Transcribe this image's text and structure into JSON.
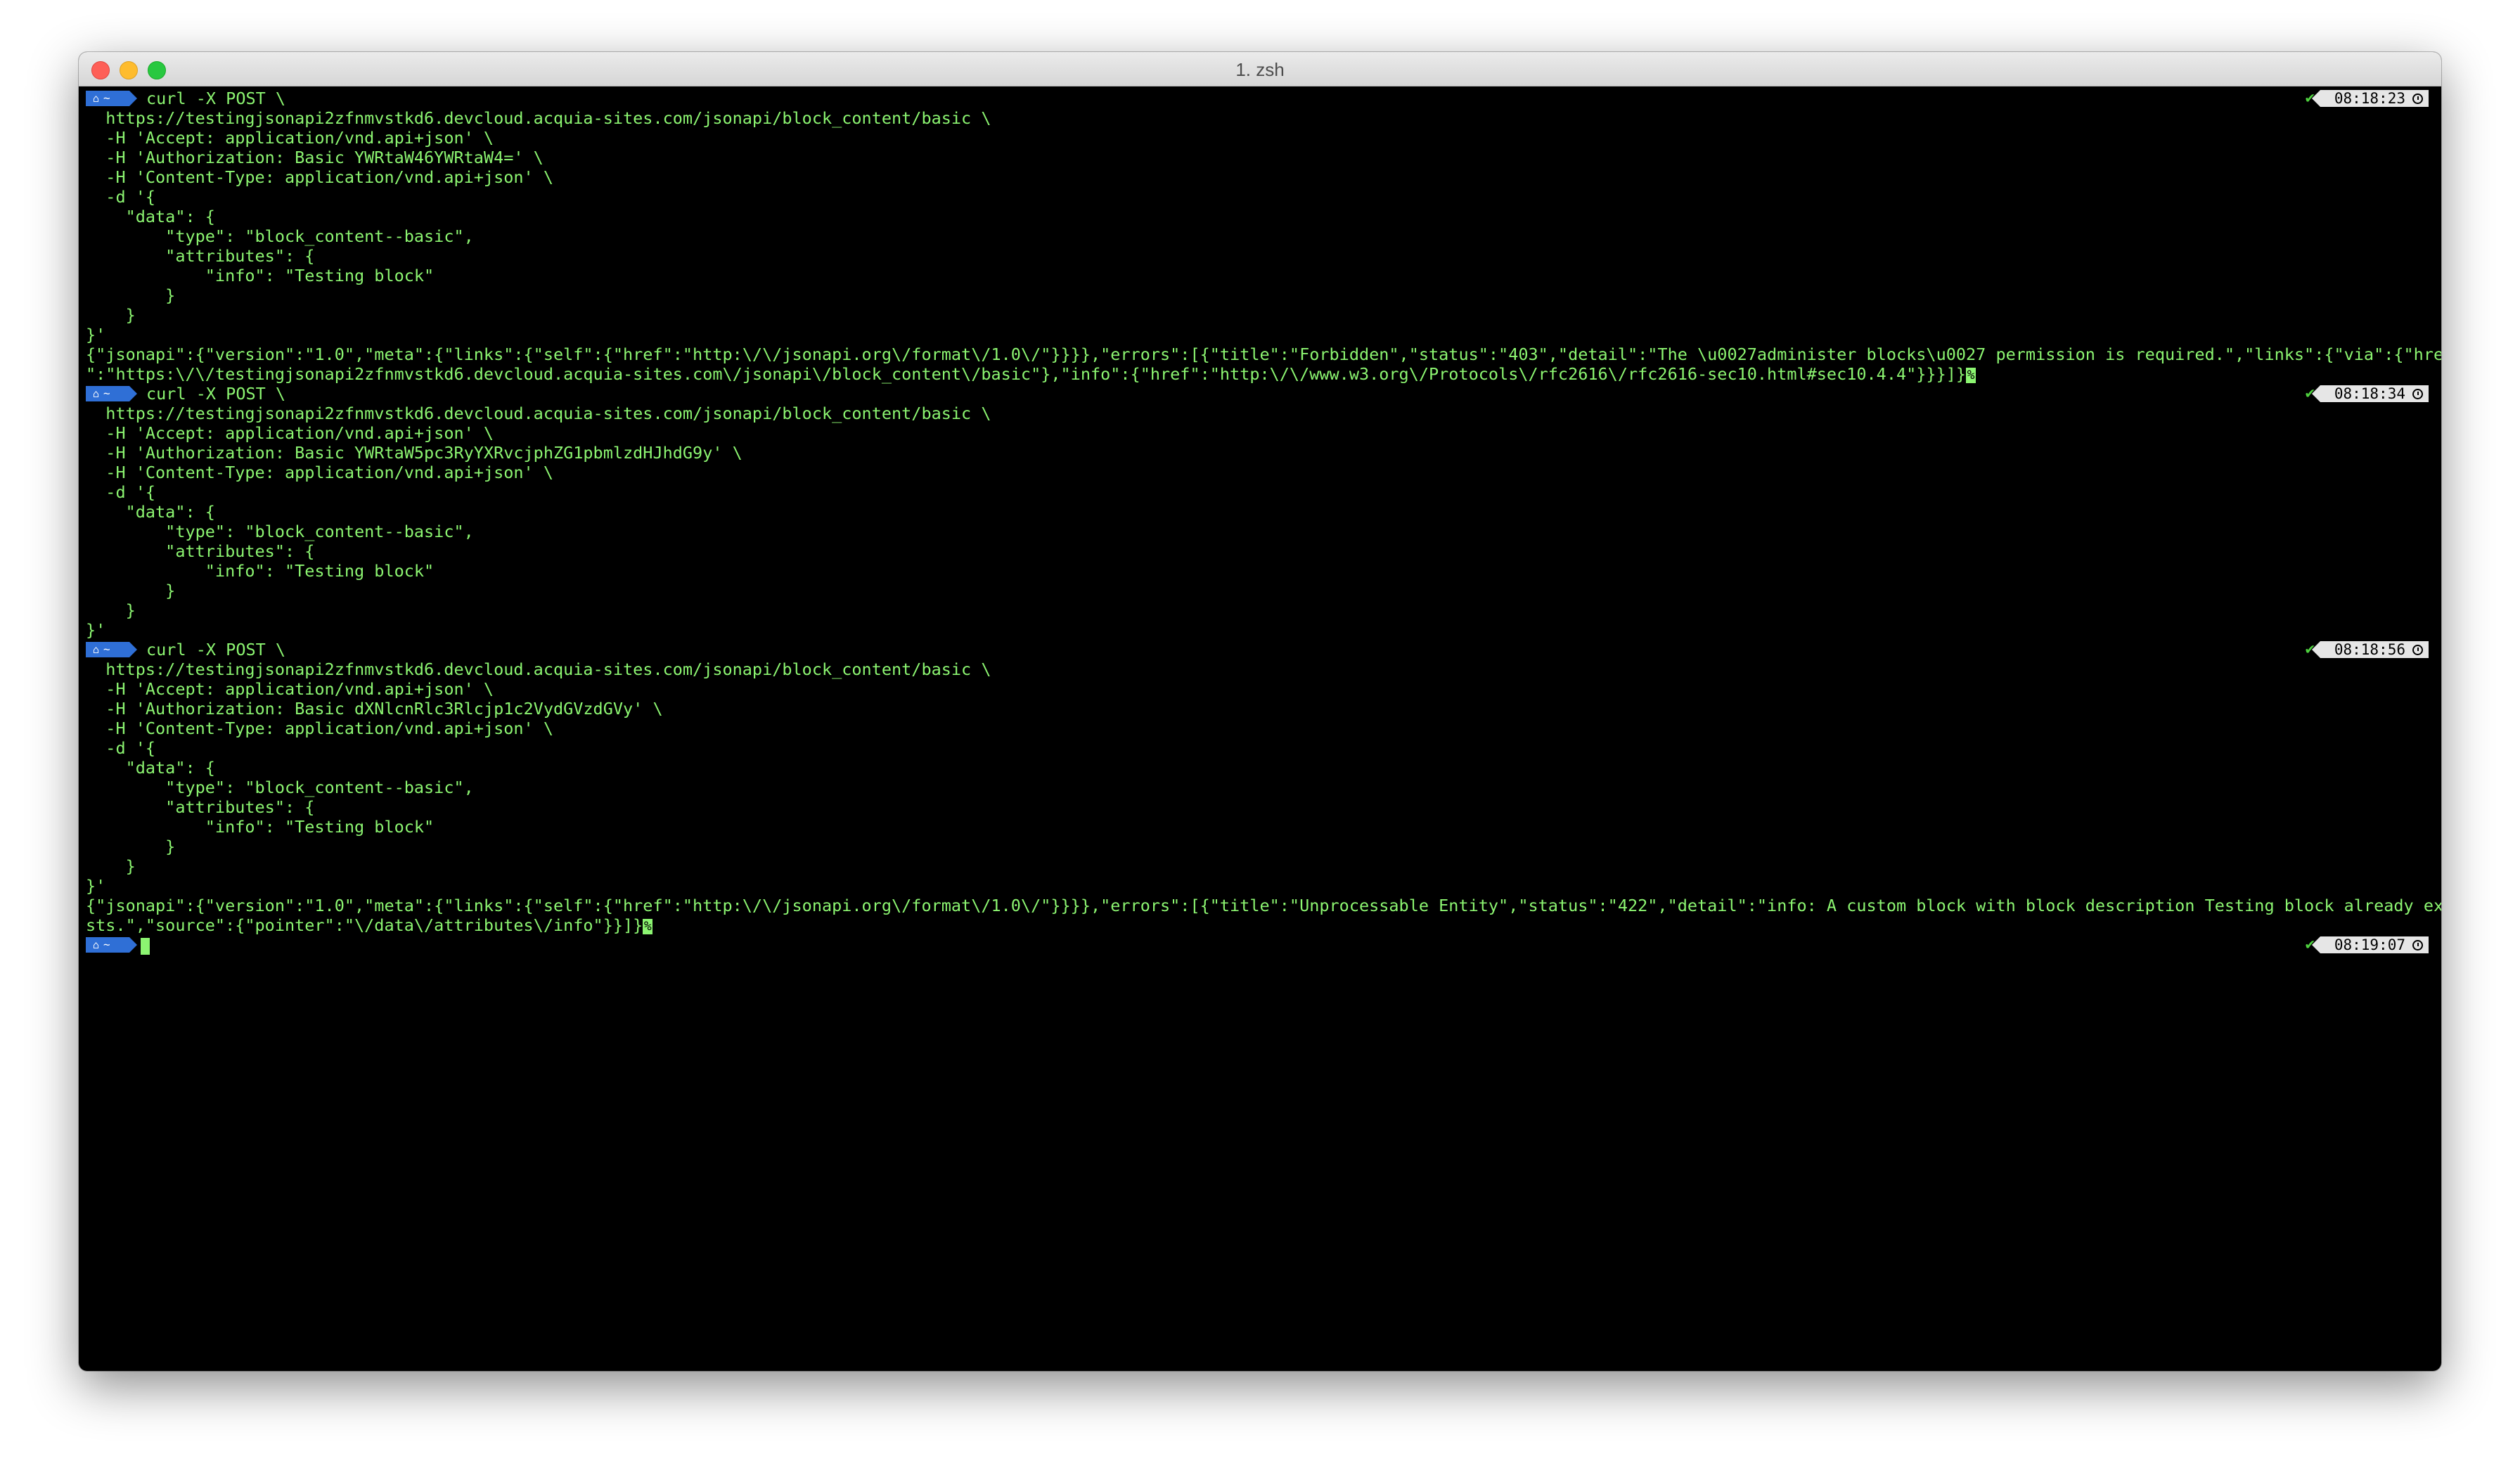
{
  "window": {
    "title": "1. zsh"
  },
  "prompt": {
    "icon": "home-icon",
    "dir": "~",
    "check": "✔",
    "clock_icon": "clock-icon"
  },
  "blocks": [
    {
      "time": "08:18:23",
      "cmd": [
        "curl -X POST \\",
        "  https://testingjsonapi2zfnmvstkd6.devcloud.acquia-sites.com/jsonapi/block_content/basic \\",
        "  -H 'Accept: application/vnd.api+json' \\",
        "  -H 'Authorization: Basic YWRtaW46YWRtaW4=' \\",
        "  -H 'Content-Type: application/vnd.api+json' \\",
        "  -d '{",
        "    \"data\": {",
        "        \"type\": \"block_content--basic\",",
        "        \"attributes\": {",
        "            \"info\": \"Testing block\"",
        "        }",
        "    }",
        "}'"
      ],
      "output": [
        "{\"jsonapi\":{\"version\":\"1.0\",\"meta\":{\"links\":{\"self\":{\"href\":\"http:\\/\\/jsonapi.org\\/format\\/1.0\\/\"}}}},\"errors\":[{\"title\":\"Forbidden\",\"status\":\"403\",\"detail\":\"The \\u0027administer blocks\\u0027 permission is required.\",\"links\":{\"via\":{\"href",
        "\":\"https:\\/\\/testingjsonapi2zfnmvstkd6.devcloud.acquia-sites.com\\/jsonapi\\/block_content\\/basic\"},\"info\":{\"href\":\"http:\\/\\/www.w3.org\\/Protocols\\/rfc2616\\/rfc2616-sec10.html#sec10.4.4\"}}}]}"
      ],
      "output_marker": "%"
    },
    {
      "time": "08:18:34",
      "cmd": [
        "curl -X POST \\",
        "  https://testingjsonapi2zfnmvstkd6.devcloud.acquia-sites.com/jsonapi/block_content/basic \\",
        "  -H 'Accept: application/vnd.api+json' \\",
        "  -H 'Authorization: Basic YWRtaW5pc3RyYXRvcjphZG1pbmlzdHJhdG9y' \\",
        "  -H 'Content-Type: application/vnd.api+json' \\",
        "  -d '{",
        "    \"data\": {",
        "        \"type\": \"block_content--basic\",",
        "        \"attributes\": {",
        "            \"info\": \"Testing block\"",
        "        }",
        "    }",
        "}'"
      ],
      "output": [],
      "output_marker": ""
    },
    {
      "time": "08:18:56",
      "cmd": [
        "curl -X POST \\",
        "  https://testingjsonapi2zfnmvstkd6.devcloud.acquia-sites.com/jsonapi/block_content/basic \\",
        "  -H 'Accept: application/vnd.api+json' \\",
        "  -H 'Authorization: Basic dXNlcnRlc3Rlcjp1c2VydGVzdGVy' \\",
        "  -H 'Content-Type: application/vnd.api+json' \\",
        "  -d '{",
        "    \"data\": {",
        "        \"type\": \"block_content--basic\",",
        "        \"attributes\": {",
        "            \"info\": \"Testing block\"",
        "        }",
        "    }",
        "}'"
      ],
      "output": [
        "{\"jsonapi\":{\"version\":\"1.0\",\"meta\":{\"links\":{\"self\":{\"href\":\"http:\\/\\/jsonapi.org\\/format\\/1.0\\/\"}}}},\"errors\":[{\"title\":\"Unprocessable Entity\",\"status\":\"422\",\"detail\":\"info: A custom block with block description Testing block already exi",
        "sts.\",\"source\":{\"pointer\":\"\\/data\\/attributes\\/info\"}}]}"
      ],
      "output_marker": "%"
    }
  ],
  "current_prompt": {
    "time": "08:19:07"
  }
}
